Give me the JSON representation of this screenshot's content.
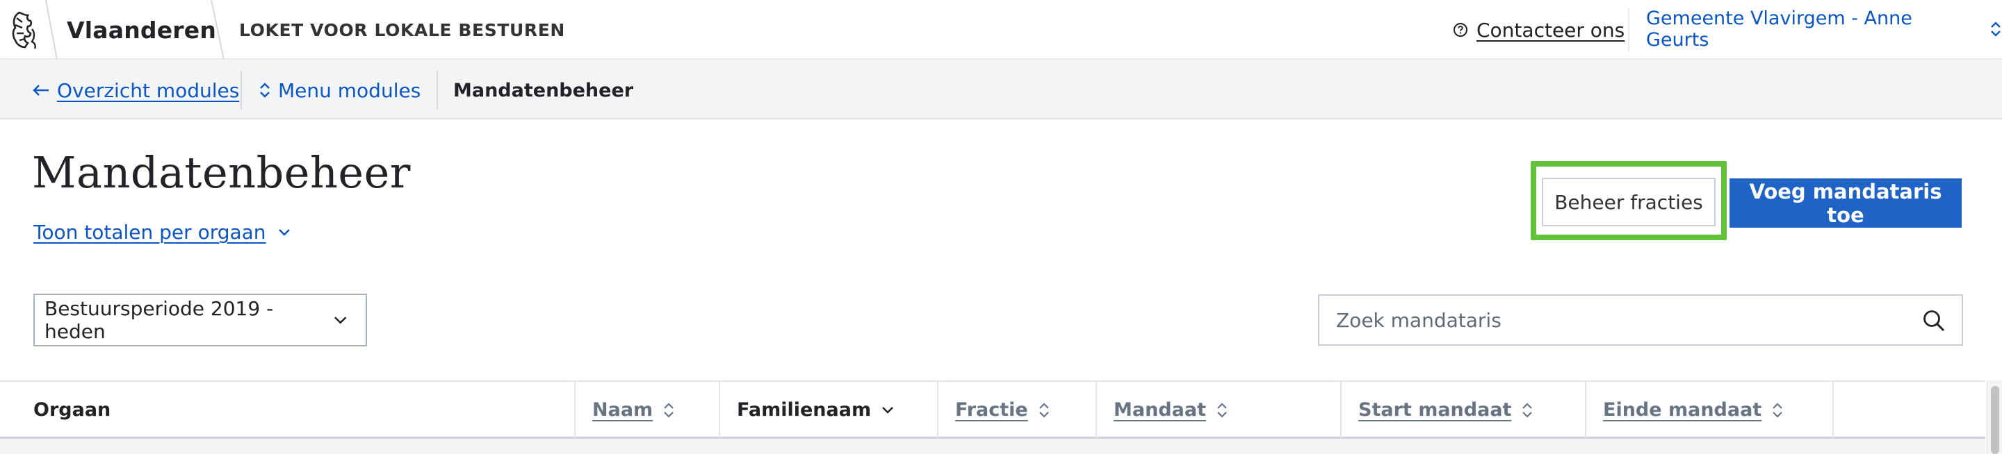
{
  "header": {
    "brand": "Vlaanderen",
    "app_title": "LOKET VOOR LOKALE BESTUREN",
    "contact_label": "Contacteer ons",
    "user_label": "Gemeente Vlavirgem - Anne Geurts"
  },
  "breadcrumb": {
    "back_label": "Overzicht modules",
    "menu_label": "Menu modules",
    "current_label": "Mandatenbeheer"
  },
  "page": {
    "title": "Mandatenbeheer",
    "totals_toggle": "Toon totalen per orgaan",
    "manage_factions_button": "Beheer fracties",
    "add_mandatary_button": "Voeg mandataris toe"
  },
  "filters": {
    "period_selected": "Bestuursperiode 2019 - heden",
    "search_placeholder": "Zoek mandataris"
  },
  "table": {
    "columns": [
      {
        "label": "Orgaan",
        "sortable": false
      },
      {
        "label": "Naam",
        "sortable": true
      },
      {
        "label": "Familienaam",
        "sortable": true,
        "active": true
      },
      {
        "label": "Fractie",
        "sortable": true
      },
      {
        "label": "Mandaat",
        "sortable": true
      },
      {
        "label": "Start mandaat",
        "sortable": true
      },
      {
        "label": "Einde mandaat",
        "sortable": true
      }
    ]
  },
  "colors": {
    "link": "#0b56c4",
    "primary_button": "#1f63c6",
    "highlight": "#62c23a"
  }
}
